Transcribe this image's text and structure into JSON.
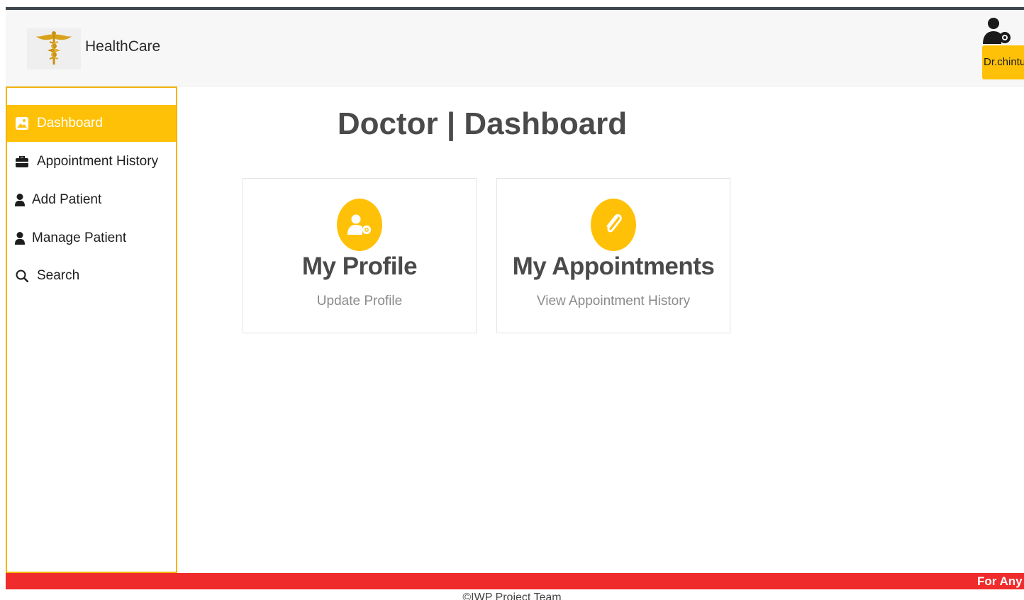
{
  "header": {
    "brand": "HealthCare",
    "user_label": "Dr.chintu",
    "logo_icon": "caduceus-icon",
    "user_icon": "user-gear-icon"
  },
  "sidebar": {
    "items": [
      {
        "label": "Dashboard",
        "icon": "image-icon",
        "active": true
      },
      {
        "label": "Appointment History",
        "icon": "briefcase-icon",
        "active": false
      },
      {
        "label": "Add Patient",
        "icon": "user-icon",
        "active": false
      },
      {
        "label": "Manage Patient",
        "icon": "user-icon",
        "active": false
      },
      {
        "label": "Search",
        "icon": "search-icon",
        "active": false
      }
    ]
  },
  "main": {
    "title": "Doctor | Dashboard",
    "cards": [
      {
        "title": "My Profile",
        "subtitle": "Update Profile",
        "icon": "user-gear-icon"
      },
      {
        "title": "My Appointments",
        "subtitle": "View Appointment History",
        "icon": "paperclip-icon"
      }
    ]
  },
  "footer": {
    "marquee": "For Any enquiry",
    "copyright": "©IWP Project Team"
  },
  "colors": {
    "accent": "#ffc107",
    "footer": "#ef2b2b",
    "topbar": "#3e454e"
  }
}
